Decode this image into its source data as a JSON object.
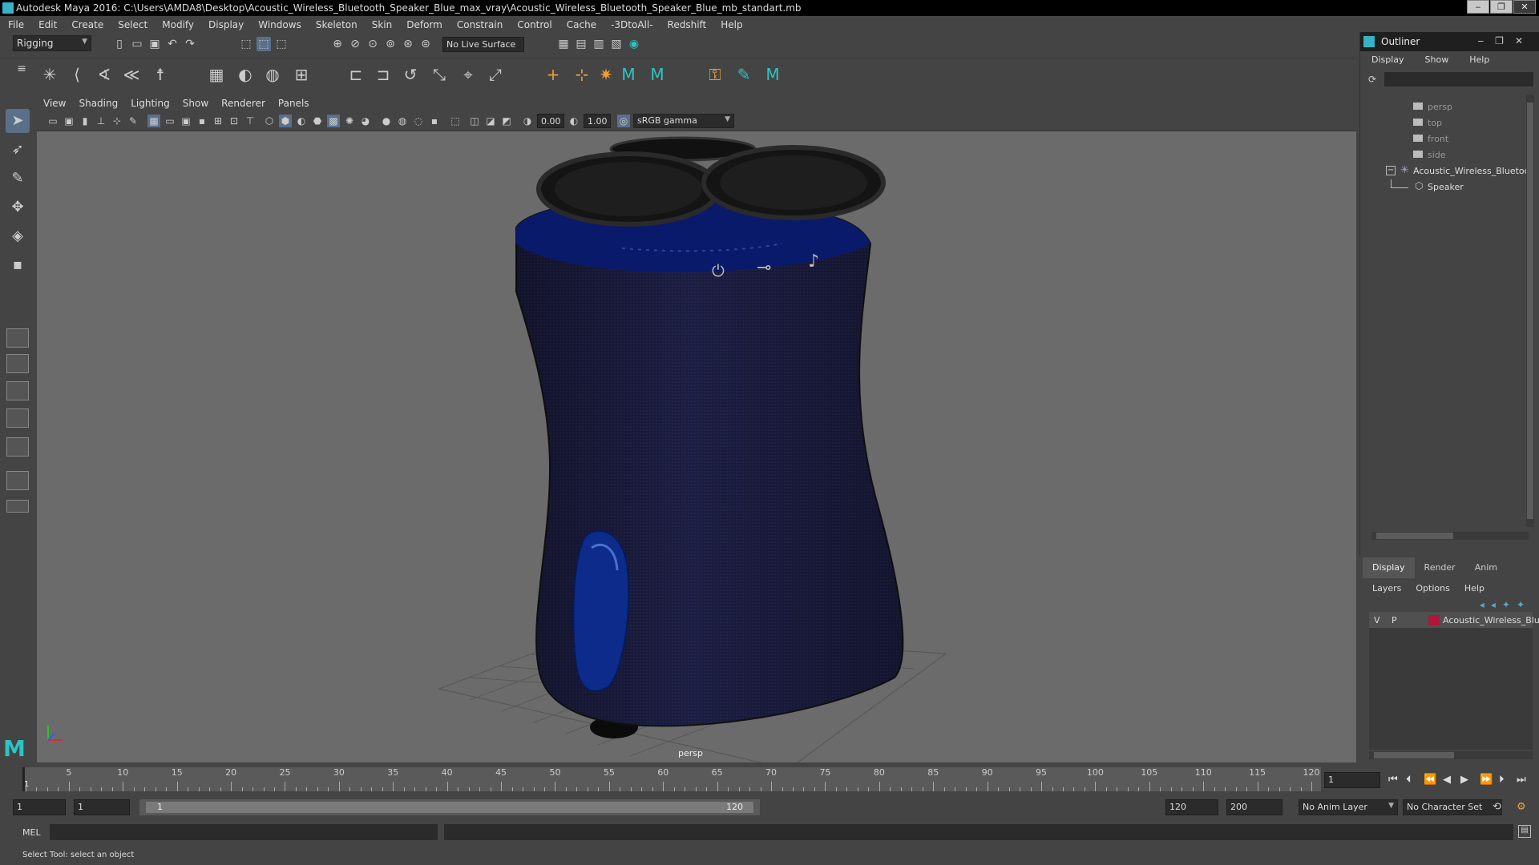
{
  "title_bar": {
    "title": "Autodesk Maya 2016: C:\\Users\\AMDA8\\Desktop\\Acoustic_Wireless_Bluetooth_Speaker_Blue_max_vray\\Acoustic_Wireless_Bluetooth_Speaker_Blue_mb_standart.mb",
    "minimize": "‒",
    "maximize": "❐",
    "close": "✕"
  },
  "menu_bar": [
    "File",
    "Edit",
    "Create",
    "Select",
    "Modify",
    "Display",
    "Windows",
    "Skeleton",
    "Skin",
    "Deform",
    "Constrain",
    "Control",
    "Cache",
    "-3DtoAll-",
    "Redshift",
    "Help"
  ],
  "status_line": {
    "menuset": "Rigging",
    "live_surface": "No Live Surface"
  },
  "panel": {
    "menu": [
      "View",
      "Shading",
      "Lighting",
      "Show",
      "Renderer",
      "Panels"
    ],
    "exposure": "0.00",
    "gamma": "1.00",
    "color_space": "sRGB gamma",
    "camera_label": "persp"
  },
  "speaker_buttons": {
    "power": "⏻",
    "connect": "⊸",
    "music": "♪"
  },
  "outliner": {
    "title": "Outliner",
    "menu": [
      "Display",
      "Show",
      "Help"
    ],
    "items": [
      {
        "label": "persp",
        "type": "camera"
      },
      {
        "label": "top",
        "type": "camera"
      },
      {
        "label": "front",
        "type": "camera"
      },
      {
        "label": "side",
        "type": "camera"
      },
      {
        "label": "Acoustic_Wireless_Bluetoo",
        "type": "group"
      },
      {
        "label": "Speaker",
        "type": "mesh"
      }
    ]
  },
  "layer_editor": {
    "tabs": [
      "Display",
      "Render",
      "Anim"
    ],
    "active_tab": "Display",
    "menu": [
      "Layers",
      "Options",
      "Help"
    ],
    "layer": {
      "v": "V",
      "p": "P",
      "name": "Acoustic_Wireless_Blu",
      "color": "#b0153a"
    }
  },
  "timeline": {
    "ticks": [
      "5",
      "10",
      "15",
      "20",
      "25",
      "30",
      "35",
      "40",
      "45",
      "50",
      "55",
      "60",
      "65",
      "70",
      "75",
      "80",
      "85",
      "90",
      "95",
      "100",
      "105",
      "110",
      "115",
      "120"
    ],
    "current_frame_marker": "1",
    "current_frame_field": "1"
  },
  "range": {
    "start_frame": "1",
    "anim_start": "1",
    "range_start_label": "1",
    "range_end_label": "120",
    "anim_end": "120",
    "end_frame": "200",
    "anim_layer": "No Anim Layer",
    "character_set": "No Character Set"
  },
  "command_line": {
    "label": "MEL"
  },
  "help_line": {
    "text": "Select Tool: select an object"
  }
}
